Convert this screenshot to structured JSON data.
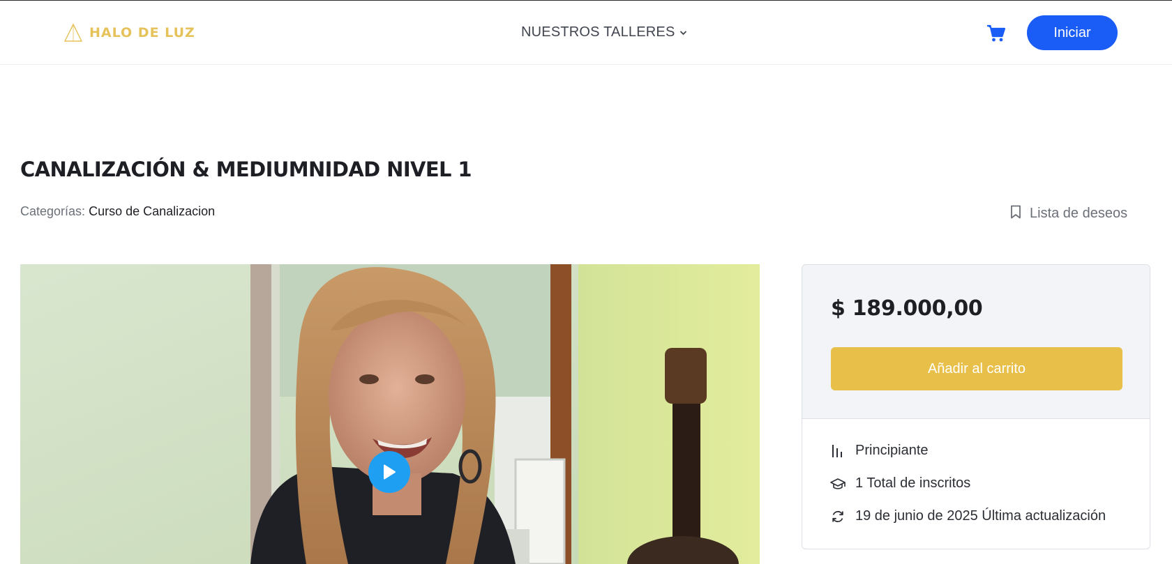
{
  "header": {
    "logo_text": "HALO DE  LUZ",
    "nav_label": "NUESTROS TALLERES",
    "login_label": "Iniciar"
  },
  "course": {
    "title": "CANALIZACIÓN & MEDIUMNIDAD NIVEL 1",
    "categories_label": "Categorías:",
    "category": "Curso de Canalizacion",
    "wishlist_label": "Lista de deseos"
  },
  "sidebar": {
    "price": "$ 189.000,00",
    "add_to_cart_label": "Añadir al carrito",
    "level": "Principiante",
    "enrolled": "1 Total de inscritos",
    "last_update": "19 de junio de 2025 Última actualización"
  },
  "colors": {
    "brand_gold": "#e6c25a",
    "primary_blue": "#1a5cf6",
    "cart_button": "#e8bf48",
    "play_button": "#1e9ff2"
  },
  "icons": {
    "logo": "triangle-logo-icon",
    "nav_dropdown": "chevron-down-icon",
    "cart": "shopping-cart-icon",
    "wishlist": "bookmark-icon",
    "play": "play-icon",
    "level": "bar-chart-icon",
    "enrolled": "graduation-cap-icon",
    "updated": "refresh-icon"
  }
}
